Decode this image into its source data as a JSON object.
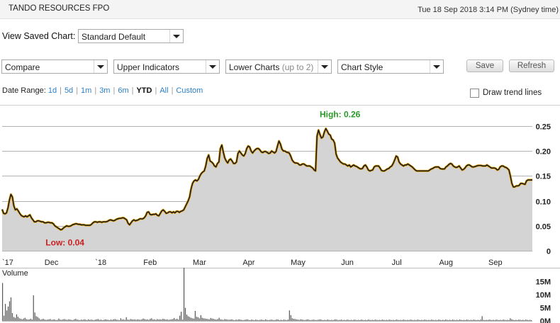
{
  "header": {
    "title": "TANDO RESOURCES FPO",
    "datetime": "Tue 18 Sep 2018 3:14 PM (Sydney time)"
  },
  "saved_chart": {
    "label": "View Saved Chart:",
    "value": "Standard Default"
  },
  "toolbar": {
    "compare": "Compare",
    "upper_indicators": "Upper Indicators",
    "lower_charts": "Lower Charts",
    "lower_charts_hint": "(up to 2)",
    "chart_style": "Chart Style",
    "save": "Save",
    "refresh": "Refresh"
  },
  "date_range": {
    "label": "Date Range:",
    "options": [
      "1d",
      "5d",
      "1m",
      "3m",
      "6m",
      "YTD",
      "All",
      "Custom"
    ],
    "selected": "YTD"
  },
  "trend_lines": {
    "label": "Draw trend lines",
    "checked": false
  },
  "colors": {
    "line": "#1a1a1a",
    "line_glow": "#e6a817",
    "area": "#d4d4d4",
    "high": "#2a9a2a",
    "low": "#cc1f1f",
    "volume_bar": "#555555"
  },
  "chart_data": [
    {
      "type": "area",
      "x_labels": [
        "`17",
        "Dec",
        "`18",
        "Feb",
        "Mar",
        "Apr",
        "May",
        "Jun",
        "Jul",
        "Aug",
        "Sep"
      ],
      "y_ticks": [
        "0.25",
        "0.20",
        "0.15",
        "0.10",
        "0.05",
        "0"
      ],
      "ylim": [
        0,
        0.25
      ],
      "grid": true,
      "high_label": "High: 0.26",
      "low_label": "Low: 0.04",
      "series": [
        {
          "values": [
            0.083,
            0.075,
            0.074,
            0.076,
            0.086,
            0.102,
            0.113,
            0.108,
            0.09,
            0.082,
            0.084,
            0.08,
            0.075,
            0.071,
            0.069,
            0.068,
            0.07,
            0.068,
            0.07,
            0.072,
            0.066,
            0.062,
            0.058,
            0.058,
            0.06,
            0.06,
            0.059,
            0.058,
            0.058,
            0.056,
            0.056,
            0.057,
            0.057,
            0.056,
            0.056,
            0.054,
            0.05,
            0.048,
            0.046,
            0.044,
            0.042,
            0.043,
            0.046,
            0.048,
            0.05,
            0.049,
            0.049,
            0.05,
            0.052,
            0.053,
            0.054,
            0.054,
            0.053,
            0.053,
            0.052,
            0.052,
            0.052,
            0.051,
            0.051,
            0.051,
            0.051,
            0.053,
            0.056,
            0.058,
            0.058,
            0.057,
            0.058,
            0.058,
            0.057,
            0.058,
            0.058,
            0.058,
            0.059,
            0.061,
            0.062,
            0.061,
            0.06,
            0.061,
            0.063,
            0.064,
            0.065,
            0.065,
            0.066,
            0.066,
            0.064,
            0.062,
            0.055,
            0.052,
            0.056,
            0.06,
            0.062,
            0.06,
            0.061,
            0.062,
            0.064,
            0.064,
            0.064,
            0.066,
            0.07,
            0.077,
            0.078,
            0.073,
            0.072,
            0.073,
            0.073,
            0.074,
            0.071,
            0.07,
            0.075,
            0.08,
            0.082,
            0.079,
            0.075,
            0.076,
            0.078,
            0.078,
            0.076,
            0.078,
            0.076,
            0.079,
            0.079,
            0.077,
            0.079,
            0.08,
            0.082,
            0.088,
            0.094,
            0.1,
            0.108,
            0.124,
            0.135,
            0.14,
            0.142,
            0.14,
            0.143,
            0.15,
            0.155,
            0.158,
            0.16,
            0.17,
            0.185,
            0.192,
            0.18,
            0.178,
            0.175,
            0.17,
            0.168,
            0.175,
            0.178,
            0.205,
            0.212,
            0.198,
            0.186,
            0.18,
            0.176,
            0.182,
            0.184,
            0.18,
            0.175,
            0.175,
            0.178,
            0.195,
            0.2,
            0.196,
            0.192,
            0.19,
            0.195,
            0.205,
            0.21,
            0.208,
            0.2,
            0.196,
            0.2,
            0.203,
            0.205,
            0.205,
            0.202,
            0.198,
            0.197,
            0.199,
            0.199,
            0.197,
            0.195,
            0.196,
            0.2,
            0.198,
            0.196,
            0.199,
            0.21,
            0.22,
            0.214,
            0.204,
            0.2,
            0.2,
            0.198,
            0.197,
            0.196,
            0.19,
            0.182,
            0.178,
            0.176,
            0.176,
            0.175,
            0.172,
            0.172,
            0.174,
            0.174,
            0.172,
            0.17,
            0.17,
            0.17,
            0.168,
            0.166,
            0.162,
            0.16,
            0.23,
            0.242,
            0.233,
            0.226,
            0.228,
            0.238,
            0.245,
            0.24,
            0.234,
            0.232,
            0.224,
            0.222,
            0.216,
            0.194,
            0.186,
            0.182,
            0.178,
            0.176,
            0.174,
            0.174,
            0.172,
            0.17,
            0.172,
            0.168,
            0.17,
            0.172,
            0.17,
            0.169,
            0.167,
            0.165,
            0.164,
            0.165,
            0.17,
            0.172,
            0.168,
            0.162,
            0.16,
            0.161,
            0.162,
            0.168,
            0.17,
            0.17,
            0.17,
            0.166,
            0.161,
            0.16,
            0.16,
            0.162,
            0.164,
            0.165,
            0.168,
            0.17,
            0.175,
            0.182,
            0.19,
            0.188,
            0.178,
            0.174,
            0.172,
            0.17,
            0.172,
            0.172,
            0.174,
            0.172,
            0.17,
            0.168,
            0.165,
            0.162,
            0.16,
            0.16,
            0.16,
            0.16,
            0.16,
            0.16,
            0.16,
            0.16,
            0.16,
            0.162,
            0.164,
            0.165,
            0.167,
            0.168,
            0.168,
            0.168,
            0.165,
            0.164,
            0.164,
            0.164,
            0.168,
            0.17,
            0.173,
            0.175,
            0.174,
            0.17,
            0.168,
            0.167,
            0.168,
            0.17,
            0.166,
            0.162,
            0.163,
            0.166,
            0.17,
            0.172,
            0.172,
            0.17,
            0.168,
            0.168,
            0.169,
            0.17,
            0.171,
            0.171,
            0.171,
            0.17,
            0.17,
            0.17,
            0.172,
            0.17,
            0.168,
            0.166,
            0.166,
            0.166,
            0.165,
            0.162,
            0.163,
            0.168,
            0.17,
            0.17,
            0.168,
            0.167,
            0.165,
            0.162,
            0.15,
            0.135,
            0.128,
            0.128,
            0.13,
            0.13,
            0.131,
            0.135,
            0.135,
            0.134,
            0.133,
            0.14,
            0.142,
            0.142,
            0.142,
            0.142
          ]
        }
      ]
    },
    {
      "type": "bar",
      "title": "Volume",
      "y_ticks": [
        "15M",
        "10M",
        "5M",
        "0M"
      ],
      "ylim": [
        0,
        16
      ],
      "series": [
        {
          "name": "Volume",
          "values": [
            14.5,
            2.0,
            6.5,
            4.0,
            5.5,
            7.5,
            9.0,
            3.0,
            1.5,
            1.2,
            2.5,
            1.6,
            1.0,
            0.8,
            0.6,
            0.9,
            1.2,
            0.7,
            0.5,
            0.6,
            0.8,
            0.5,
            9.8,
            3.2,
            1.8,
            1.5,
            1.0,
            0.5,
            0.6,
            0.8,
            0.5,
            0.4,
            0.5,
            0.6,
            0.7,
            0.4,
            0.5,
            0.6,
            0.3,
            0.4,
            0.9,
            0.5,
            0.4,
            0.6,
            0.7,
            0.5,
            0.4,
            0.6,
            0.5,
            0.4,
            0.3,
            0.6,
            0.8,
            0.5,
            0.4,
            0.3,
            0.5,
            0.4,
            0.6,
            0.5,
            0.3,
            0.6,
            0.4,
            0.5,
            0.4,
            0.3,
            0.5,
            0.6,
            0.7,
            0.4,
            0.5,
            0.3,
            0.4,
            0.6,
            0.5,
            0.4,
            0.3,
            0.5,
            0.4,
            0.6,
            0.7,
            0.5,
            0.4,
            0.3,
            1.0,
            0.5,
            0.6,
            0.4,
            1.4,
            0.5,
            0.4,
            0.7,
            0.6,
            0.5,
            0.6,
            0.4,
            0.6,
            0.5,
            0.4,
            0.6,
            0.9,
            0.7,
            0.5,
            0.6,
            0.4,
            0.8,
            1.0,
            0.5,
            0.6,
            0.4,
            0.7,
            0.5,
            0.6,
            0.5,
            0.8,
            0.7,
            0.5,
            0.6,
            0.4,
            0.5,
            0.6,
            0.7,
            1.1,
            0.6,
            0.8,
            0.5,
            2.0,
            3.5,
            0.5,
            19.0,
            5.0,
            2.4,
            1.8,
            1.5,
            1.2,
            1.0,
            0.9,
            3.8,
            1.6,
            1.4,
            1.0,
            2.2,
            1.2,
            1.0,
            0.9,
            0.8,
            0.7,
            0.6,
            1.1,
            0.9,
            0.8,
            0.6,
            0.5,
            0.7,
            1.2,
            0.6,
            0.5,
            0.4,
            0.7,
            0.6,
            0.5,
            0.4,
            0.5,
            0.6,
            0.4,
            0.3,
            0.5,
            0.4,
            0.6,
            0.5,
            0.4,
            0.3,
            0.4,
            0.5,
            0.6,
            0.4,
            0.3,
            0.5,
            0.4,
            0.3,
            0.5,
            0.4,
            0.3,
            0.4,
            0.5,
            0.4,
            0.3,
            0.6,
            0.4,
            0.3,
            0.4,
            0.5,
            0.4,
            0.3,
            0.4,
            0.6,
            0.5,
            0.3,
            0.4,
            0.3,
            0.5,
            0.4,
            0.3,
            0.5,
            4.0,
            2.2,
            1.0,
            0.8,
            0.7,
            0.6,
            0.5,
            0.4,
            0.6,
            0.5,
            0.4,
            0.3,
            0.5,
            0.6,
            0.4,
            0.3,
            0.4,
            0.5,
            0.4,
            0.3,
            0.4,
            0.5,
            0.6,
            0.4,
            0.3,
            0.4,
            0.3,
            0.5,
            0.4,
            0.3,
            0.4,
            0.3,
            0.5,
            0.6,
            0.4,
            0.3,
            0.4,
            0.5,
            0.3,
            0.4,
            0.3,
            0.5,
            0.4,
            0.3,
            0.4,
            0.3,
            0.5,
            0.4,
            0.3,
            0.4,
            0.3,
            0.5,
            0.4,
            0.3,
            0.4,
            0.3,
            0.5,
            0.4,
            0.3,
            0.4,
            0.3,
            0.5,
            0.4,
            0.3,
            0.4,
            0.3,
            0.5,
            0.4,
            0.3,
            0.4,
            0.3,
            0.5,
            0.4,
            0.3,
            0.4,
            0.3,
            0.5,
            0.4,
            0.3,
            0.4,
            0.3,
            0.5,
            0.4,
            0.3,
            0.4,
            0.3,
            0.5,
            0.4,
            0.3,
            0.4,
            0.3,
            0.5,
            0.4,
            0.3,
            0.4,
            0.3,
            0.5,
            0.4,
            0.3,
            0.4,
            0.3,
            0.5,
            0.4,
            0.3,
            0.4,
            0.3,
            0.5,
            0.4,
            0.3,
            0.4,
            0.3,
            0.5,
            0.4,
            0.3,
            0.4,
            0.3,
            0.5,
            0.4,
            0.3,
            0.4,
            0.3,
            0.5,
            0.4,
            0.3,
            0.4,
            0.3,
            0.5,
            0.4,
            0.3,
            0.4,
            0.3,
            0.5,
            0.4,
            0.3,
            0.4,
            0.3,
            0.5,
            1.8,
            0.4,
            0.3,
            0.4,
            0.3,
            0.5,
            0.4,
            0.3,
            0.4,
            0.3,
            0.5,
            0.4,
            0.3,
            0.4,
            0.3,
            0.5,
            0.4,
            0.3,
            0.4,
            0.3,
            1.0,
            0.6,
            0.4,
            0.3,
            0.4,
            0.3,
            0.5,
            0.4,
            0.3,
            0.4,
            0.3,
            0.5,
            0.4,
            0.3,
            0.4,
            0.3
          ]
        }
      ]
    }
  ]
}
